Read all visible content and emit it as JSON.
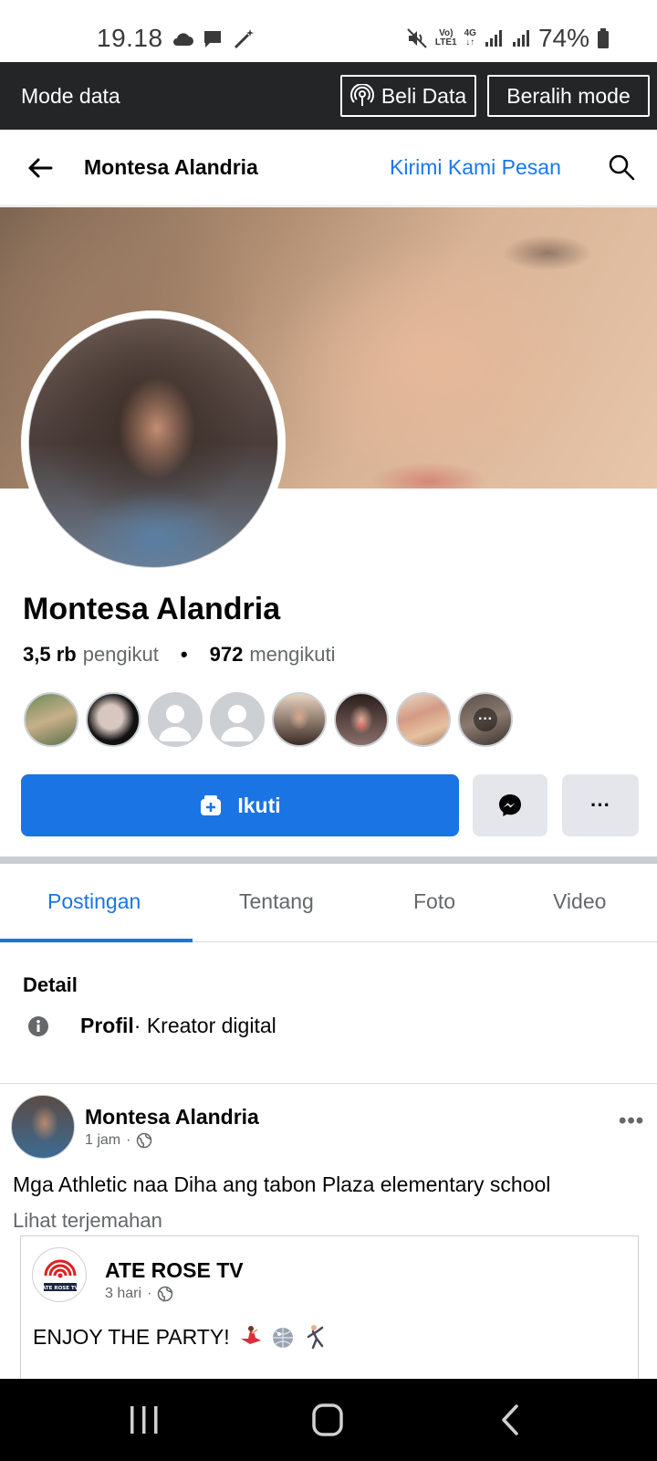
{
  "status_bar": {
    "time": "19.18",
    "net_top": "Vo)",
    "net_bottom": "LTE1",
    "gen_top": "4G",
    "battery": "74%"
  },
  "data_bar": {
    "label": "Mode data",
    "buy_label": "Beli Data",
    "switch_label": "Beralih mode"
  },
  "header": {
    "title": "Montesa Alandria",
    "message_link": "Kirimi Kami Pesan"
  },
  "profile": {
    "name": "Montesa Alandria",
    "followers_count": "3,5 rb",
    "followers_label": "pengikut",
    "following_count": "972",
    "following_label": "mengikuti",
    "follow_button": "Ikuti",
    "more_button": "···"
  },
  "tabs": [
    {
      "label": "Postingan"
    },
    {
      "label": "Tentang"
    },
    {
      "label": "Foto"
    },
    {
      "label": "Video"
    }
  ],
  "details": {
    "title": "Detail",
    "profile_label": "Profil",
    "profile_value": " · Kreator digital"
  },
  "post": {
    "author": "Montesa Alandria",
    "time": "1 jam",
    "text": "Mga Athletic naa Diha ang tabon Plaza elementary school",
    "see_translation": "Lihat terjemahan",
    "more": "•••",
    "shared": {
      "author": "ATE ROSE TV",
      "time": "3 hari",
      "logo_text": "ATE ROSE TV",
      "text": "ENJOY THE PARTY!"
    }
  },
  "colors": {
    "accent": "#1b74e4",
    "dark_bar": "#242526",
    "muted_text": "#65676b"
  }
}
